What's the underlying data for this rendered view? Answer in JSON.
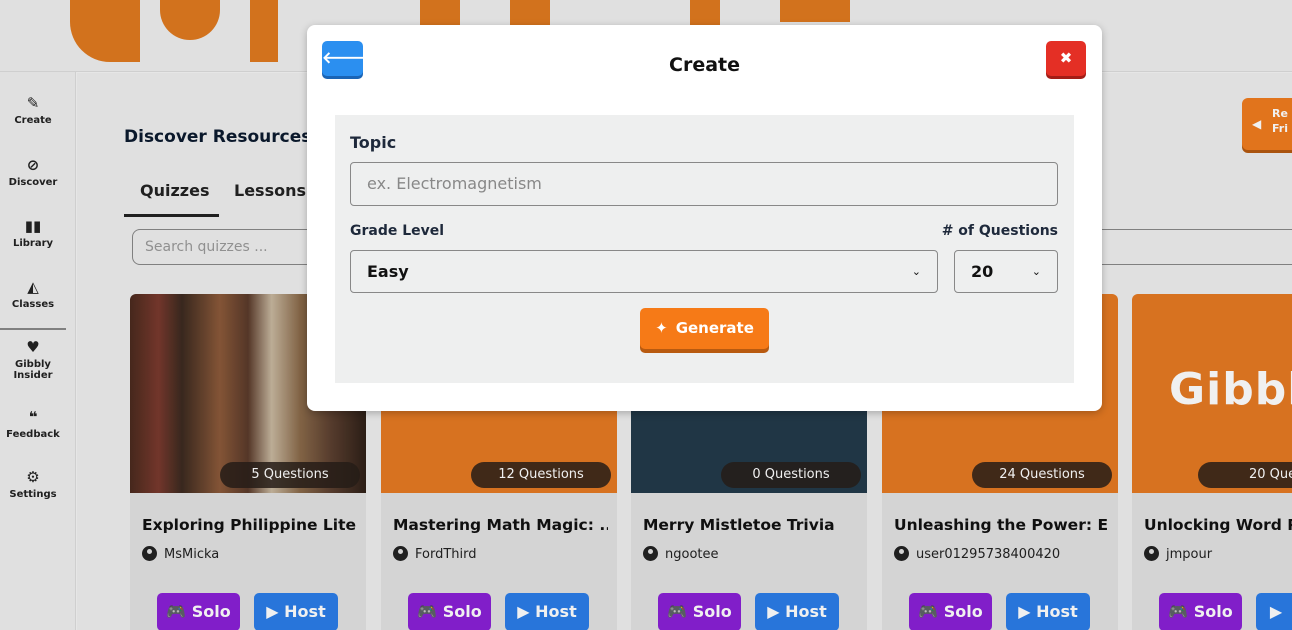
{
  "sidebar": {
    "items": [
      {
        "label": "Create",
        "icon": "✎"
      },
      {
        "label": "Discover",
        "icon": "⊘"
      },
      {
        "label": "Library",
        "icon": "▮▮"
      },
      {
        "label": "Classes",
        "icon": "◭"
      },
      {
        "label": "Gibbly Insider",
        "icon": "♥"
      },
      {
        "label": "Feedback",
        "icon": "❝"
      },
      {
        "label": "Settings",
        "icon": "⚙"
      }
    ]
  },
  "main": {
    "title": "Discover Resources",
    "tabs": [
      "Quizzes",
      "Lessons"
    ],
    "search_placeholder": "Search quizzes ...",
    "refer_label": "Re Fri"
  },
  "cards": [
    {
      "questions": "5 Questions",
      "title": "Exploring Philippine Liter...",
      "author": "MsMicka",
      "solo": "Solo",
      "host": "Host"
    },
    {
      "questions": "12 Questions",
      "title": "Mastering Math Magic: ...",
      "author": "FordThird",
      "solo": "Solo",
      "host": "Host"
    },
    {
      "questions": "0 Questions",
      "title": "Merry Mistletoe Trivia",
      "author": "ngootee",
      "solo": "Solo",
      "host": "Host"
    },
    {
      "questions": "24 Questions",
      "title": "Unleashing the Power: E...",
      "author": "user01295738400420",
      "solo": "Solo",
      "host": "Host"
    },
    {
      "questions": "20 Que",
      "title": "Unlocking Word Po",
      "author": "jmpour",
      "solo": "Solo",
      "host": "",
      "cover_text": "Gibbl"
    }
  ],
  "modal": {
    "title": "Create",
    "back_icon": "arrow-left-icon",
    "close_icon": "close-icon",
    "topic_label": "Topic",
    "topic_placeholder": "ex. Electromagnetism",
    "grade_label": "Grade Level",
    "grade_value": "Easy",
    "count_label": "# of Questions",
    "count_value": "20",
    "generate_label": "Generate"
  },
  "colors": {
    "accent_orange": "#f67a17",
    "blue": "#2b8ff0",
    "red": "#e42f25",
    "purple": "#8a20d6"
  }
}
